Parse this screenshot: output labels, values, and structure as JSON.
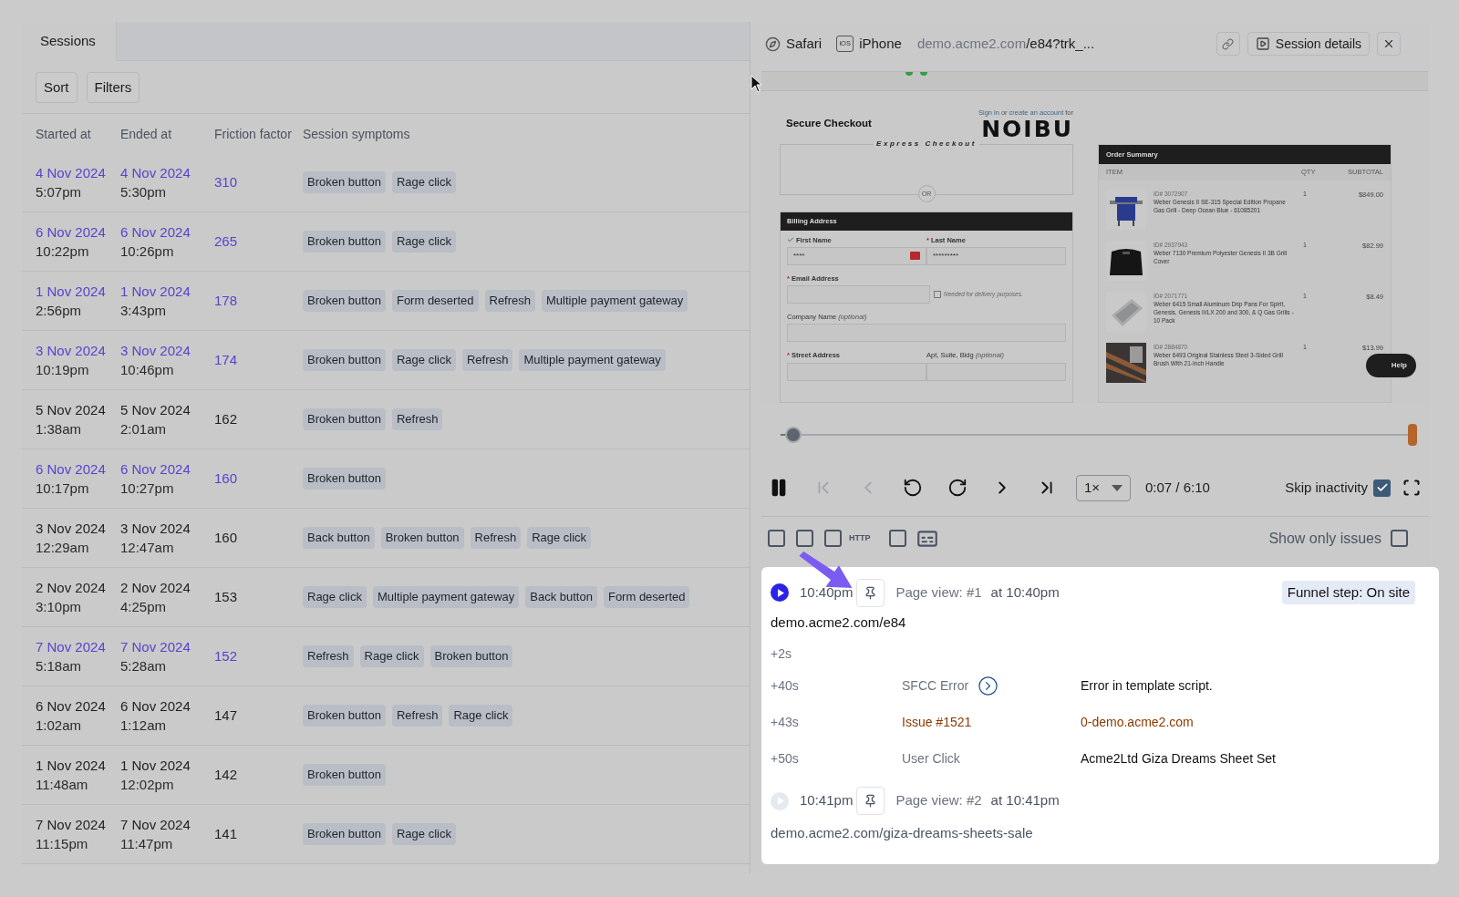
{
  "sessions_tab": {
    "label": "Sessions",
    "selected": true
  },
  "toolbar_buttons": [
    "Sort",
    "Filters"
  ],
  "table": {
    "columns": [
      "Started at",
      "Ended at",
      "Friction factor",
      "Session symptoms"
    ],
    "rows": [
      {
        "started_date": "4 Nov 2024",
        "started_time": "5:07pm",
        "ended_date": "4 Nov 2024",
        "ended_time": "5:30pm",
        "friction": "310",
        "symptoms": [
          "Broken button",
          "Rage click"
        ],
        "highlighted": true
      },
      {
        "started_date": "6 Nov 2024",
        "started_time": "10:22pm",
        "ended_date": "6 Nov 2024",
        "ended_time": "10:26pm",
        "friction": "265",
        "symptoms": [
          "Broken button",
          "Rage click"
        ],
        "highlighted": true
      },
      {
        "started_date": "1 Nov 2024",
        "started_time": "2:56pm",
        "ended_date": "1 Nov 2024",
        "ended_time": "3:43pm",
        "friction": "178",
        "symptoms": [
          "Broken button",
          "Form deserted",
          "Refresh",
          "Multiple payment gateway"
        ],
        "highlighted": true
      },
      {
        "started_date": "3 Nov 2024",
        "started_time": "10:19pm",
        "ended_date": "3 Nov 2024",
        "ended_time": "10:46pm",
        "friction": "174",
        "symptoms": [
          "Broken button",
          "Rage click",
          "Refresh",
          "Multiple payment gateway"
        ],
        "highlighted": true
      },
      {
        "started_date": "5 Nov 2024",
        "started_time": "1:38am",
        "ended_date": "5 Nov 2024",
        "ended_time": "2:01am",
        "friction": "162",
        "symptoms": [
          "Broken button",
          "Refresh"
        ],
        "highlighted": false
      },
      {
        "started_date": "6 Nov 2024",
        "started_time": "10:17pm",
        "ended_date": "6 Nov 2024",
        "ended_time": "10:27pm",
        "friction": "160",
        "symptoms": [
          "Broken button"
        ],
        "highlighted": true
      },
      {
        "started_date": "3 Nov 2024",
        "started_time": "12:29am",
        "ended_date": "3 Nov 2024",
        "ended_time": "12:47am",
        "friction": "160",
        "symptoms": [
          "Back button",
          "Broken button",
          "Refresh",
          "Rage click"
        ],
        "highlighted": false
      },
      {
        "started_date": "2 Nov 2024",
        "started_time": "3:10pm",
        "ended_date": "2 Nov 2024",
        "ended_time": "4:25pm",
        "friction": "153",
        "symptoms": [
          "Rage click",
          "Multiple payment gateway",
          "Back button",
          "Form deserted"
        ],
        "highlighted": false
      },
      {
        "started_date": "7 Nov 2024",
        "started_time": "5:18am",
        "ended_date": "7 Nov 2024",
        "ended_time": "5:28am",
        "friction": "152",
        "symptoms": [
          "Refresh",
          "Rage click",
          "Broken button"
        ],
        "highlighted": true
      },
      {
        "started_date": "6 Nov 2024",
        "started_time": "1:02am",
        "ended_date": "6 Nov 2024",
        "ended_time": "1:12am",
        "friction": "147",
        "symptoms": [
          "Broken button",
          "Refresh",
          "Rage click"
        ],
        "highlighted": false
      },
      {
        "started_date": "1 Nov 2024",
        "started_time": "11:48am",
        "ended_date": "1 Nov 2024",
        "ended_time": "12:02pm",
        "friction": "142",
        "symptoms": [
          "Broken button"
        ],
        "highlighted": false
      },
      {
        "started_date": "7 Nov 2024",
        "started_time": "11:15pm",
        "ended_date": "7 Nov 2024",
        "ended_time": "11:47pm",
        "friction": "141",
        "symptoms": [
          "Broken button",
          "Rage click"
        ],
        "highlighted": false
      }
    ]
  },
  "player": {
    "browser": "Safari",
    "device_badge": "iOS",
    "device": "iPhone",
    "url_host": "demo.acme2.com",
    "url_path": "/e84?trk_...",
    "session_details": "Session details",
    "preview": {
      "heading": "Secure Checkout",
      "sign_in": "Sign in",
      "or_text": "or",
      "create_account": "create an account",
      "for_text": "for",
      "logo": "NOIBU",
      "express": "Express Checkout",
      "divider": "OR",
      "billing": {
        "title": "Billing Address",
        "rows": [
          [
            {
              "label": "First Name",
              "valid": true,
              "value": "****",
              "autofill": true
            },
            {
              "label": "Last Name",
              "required_mark": "*",
              "value": "*********"
            }
          ],
          [
            {
              "label": "Email Address",
              "required_mark": "*",
              "note": "Needed for delivery purposes.",
              "note_checked": false
            }
          ],
          [
            {
              "label": "Company Name",
              "optional": "(optional)"
            }
          ],
          [
            {
              "label": "Street Address",
              "required_mark": "*"
            },
            {
              "label": "Apt, Suite, Bldg",
              "optional": "(optional)"
            }
          ]
        ]
      },
      "order": {
        "title": "Order Summary",
        "columns": [
          "ITEM",
          "QTY",
          "SUBTOTAL"
        ],
        "items": [
          {
            "id": "ID# 3072907",
            "name": "Weber Genesis II SE-315 Special Edition Propane Gas Grill - Deep Ocean Blue - 61085201",
            "qty": "1",
            "price": "$849.00"
          },
          {
            "id": "ID# 2937943",
            "name": "Weber 7130 Premium Polyester Genesis II 3B Grill Cover",
            "qty": "1",
            "price": "$82.99"
          },
          {
            "id": "ID# 2071771",
            "name": "Weber 6415 Small Aluminum Drip Pans For Spirit, Genesis, Genesis II/LX 200 and 300, & Q Gas Grills - 10 Pack",
            "qty": "1",
            "price": "$8.49"
          },
          {
            "id": "ID# 2884870",
            "name": "Weber 6493 Original Stainless Steel 3-Sided Grill Brush With 21-Inch Handle",
            "qty": "1",
            "price": "$13.99"
          }
        ]
      },
      "help": "Help"
    },
    "timeline": {
      "level": 0.02
    },
    "controls": {
      "speed": "1×",
      "time": "0:07 / 6:10",
      "skip_inactivity": {
        "label": "Skip inactivity",
        "checked": true
      }
    },
    "filters": [
      {
        "kind": "checkbox",
        "checked": false
      },
      {
        "kind": "checkbox",
        "checked": false
      },
      {
        "kind": "checkbox",
        "label": "HTTP",
        "checked": false
      },
      {
        "kind": "checkbox",
        "checked": false
      },
      {
        "kind": "captions"
      }
    ],
    "show_only_issues": {
      "label": "Show only issues",
      "checked": false
    },
    "page_views": [
      {
        "time": "10:40pm",
        "title": "Page view: #1",
        "at": "at 10:40pm",
        "active": true,
        "funnel": "Funnel step: On site",
        "url": "demo.acme2.com/e84",
        "events": [
          {
            "offset": "+2s",
            "kind": "plain"
          },
          {
            "offset": "+40s",
            "type": "SFCC Error",
            "detail": "Error in template script.",
            "kind": "error"
          },
          {
            "offset": "+43s",
            "type": "Issue #1521",
            "detail": "0-demo.acme2.com",
            "kind": "issue"
          },
          {
            "offset": "+50s",
            "type": "User Click",
            "detail": "Acme2Ltd Giza Dreams Sheet Set",
            "kind": "click"
          }
        ]
      },
      {
        "time": "10:41pm",
        "title": "Page view: #2",
        "at": "at 10:41pm",
        "active": false,
        "url": "demo.acme2.com/giza-dreams-sheets-sale"
      }
    ]
  }
}
